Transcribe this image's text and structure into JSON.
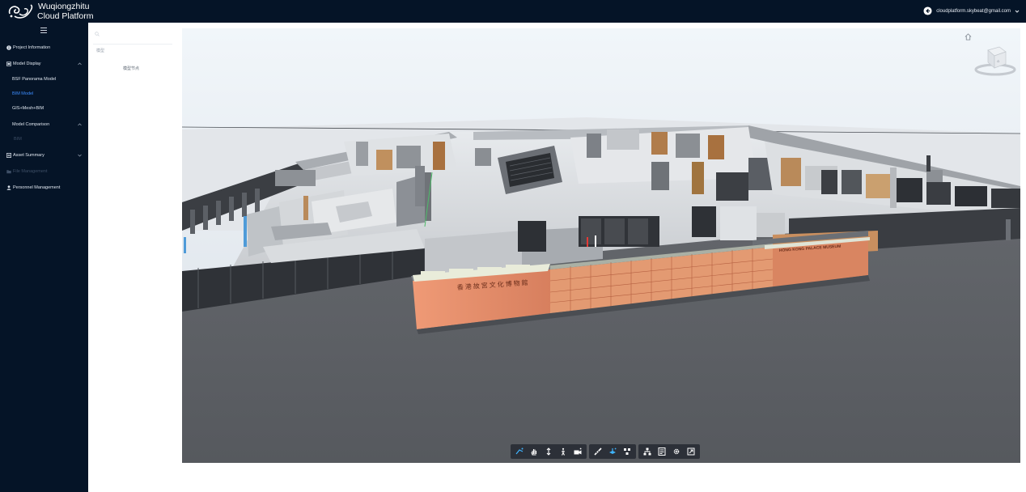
{
  "app": {
    "brand_line1": "Wuqiongzhitu",
    "brand_line2": "Cloud Platform",
    "user_email": "cloudplatform.skybeat@gmail.com"
  },
  "sidebar": {
    "items": [
      {
        "label": "Project Information",
        "icon": "info-circle-icon"
      },
      {
        "label": "Model Display",
        "icon": "model-display-icon"
      },
      {
        "label": "BSF Panorama Model"
      },
      {
        "label": "BIM Model"
      },
      {
        "label": "GIS+Mesh+BIM"
      },
      {
        "label": "Model Comparison"
      },
      {
        "label": "BIM"
      },
      {
        "label": "Asset Summary",
        "icon": "asset-summary-icon"
      },
      {
        "label": "File Management",
        "icon": "folder-icon"
      },
      {
        "label": "Personnel Management",
        "icon": "user-icon"
      }
    ]
  },
  "tree": {
    "search_placeholder": "",
    "section_label": "模型",
    "node_label": "模型节点"
  },
  "model_signs": {
    "chinese": "香港故宮文化博物館",
    "english": "HONG KONG PALACE MUSEUM"
  },
  "toolbar": {
    "groups": [
      [
        "orbit-icon",
        "pan-icon",
        "elevation-icon",
        "walk-icon",
        "camera-icon"
      ],
      [
        "measure-icon",
        "section-icon",
        "explode-icon"
      ],
      [
        "structure-tree-icon",
        "properties-icon",
        "settings-icon",
        "fullscreen-icon"
      ]
    ]
  },
  "colors": {
    "topbar": "#051427",
    "sidebar": "#051427",
    "active_menu": "#3c8dff",
    "facade": "#e28a66"
  }
}
